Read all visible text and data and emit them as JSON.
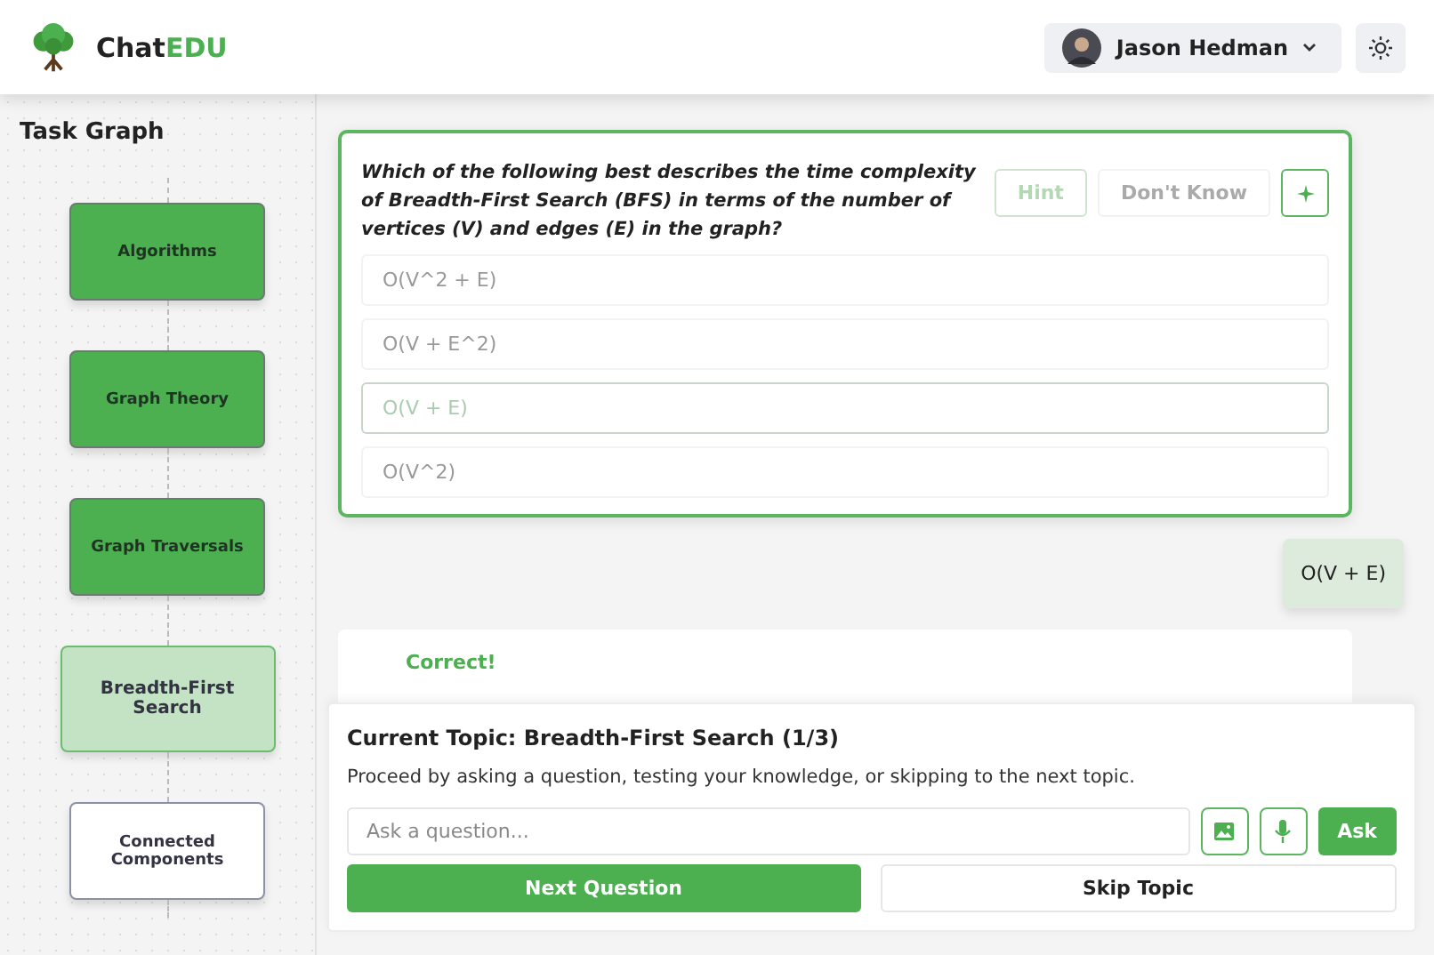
{
  "header": {
    "logo": {
      "prefix": "Chat",
      "accent": "EDU"
    },
    "user": {
      "name": "Jason Hedman"
    }
  },
  "sidebar": {
    "title": "Task Graph",
    "nodes": [
      {
        "label": "Algorithms",
        "kind": "done"
      },
      {
        "label": "Graph Theory",
        "kind": "done"
      },
      {
        "label": "Graph Traversals",
        "kind": "done"
      },
      {
        "label": "Breadth-First Search",
        "kind": "current"
      },
      {
        "label": "Connected Components",
        "kind": "pending"
      }
    ]
  },
  "question": {
    "text": "Which of the following best describes the time complexity of Breadth-First Search (BFS) in terms of the number of vertices (V) and edges (E) in the graph?",
    "buttons": [
      {
        "label": "Hint",
        "kind": "outline"
      },
      {
        "label": "Don't Know",
        "kind": "plain"
      }
    ],
    "options": [
      {
        "label": "O(V^2 + E)",
        "selected": false
      },
      {
        "label": "O(V + E^2)",
        "selected": false
      },
      {
        "label": "O(V + E)",
        "selected": true
      },
      {
        "label": "O(V^2)",
        "selected": false
      }
    ]
  },
  "user_message": "O(V + E)",
  "feedback": {
    "title": "Correct!"
  },
  "panel": {
    "topic": "Current Topic: Breadth-First Search (1/3)",
    "hint": "Proceed by asking a question, testing your knowledge, or skipping to the next topic.",
    "input": {
      "placeholder": "Ask a question..."
    },
    "ask": "Ask",
    "next": "Next Question",
    "skip": "Skip Topic"
  }
}
